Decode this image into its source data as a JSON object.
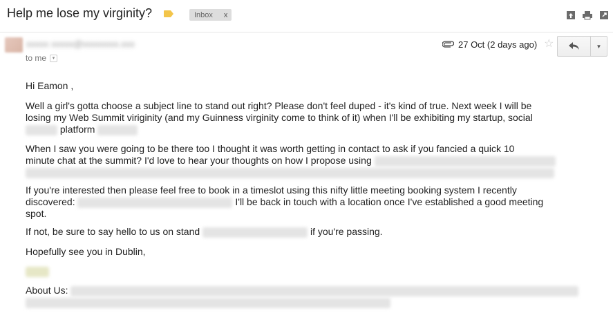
{
  "email": {
    "subject": "Help me lose my virginity?",
    "label_chip": {
      "text": "Inbox",
      "close": "x"
    },
    "recipient": "to me",
    "date": "27 Oct (2 days ago)",
    "body": {
      "greeting": "Hi Eamon ,",
      "p1_line1": "Well a girl's gotta choose a subject line to stand out right?   Please don't feel duped - it's kind of true. Next week I will be",
      "p1_line2": "losing my Web Summit viriginity (and my Guinness virginity come to think of it) when I'll be exhibiting my startup, social",
      "p1_line3_word": "platform",
      "p2_line1": "When I saw you were going to be there too I thought it was worth getting in contact to ask if you fancied a quick 10",
      "p2_line2": "minute chat at the summit?  I'd love to hear your thoughts on how I propose using",
      "p3_line1": "If you're interested then please feel free to book in a timeslot using this nifty little meeting booking system I recently",
      "p3_line2a": "discovered:",
      "p3_line2b": "I'll be back in touch with a location once I've established a good meeting",
      "p3_line3": "spot.",
      "p4a": "If not, be sure to say hello to us on stand",
      "p4b": "if you're passing.",
      "closing": "Hopefully see you in Dublin,",
      "about_label": "About Us:"
    }
  },
  "colors": {
    "label_tag": "#f3c54a",
    "chip_bg": "#dddddd"
  },
  "icons": [
    "label-tag-icon",
    "archive-icon",
    "print-icon",
    "new-window-icon",
    "attachment-icon",
    "star-icon",
    "reply-icon",
    "chevron-down-icon"
  ]
}
